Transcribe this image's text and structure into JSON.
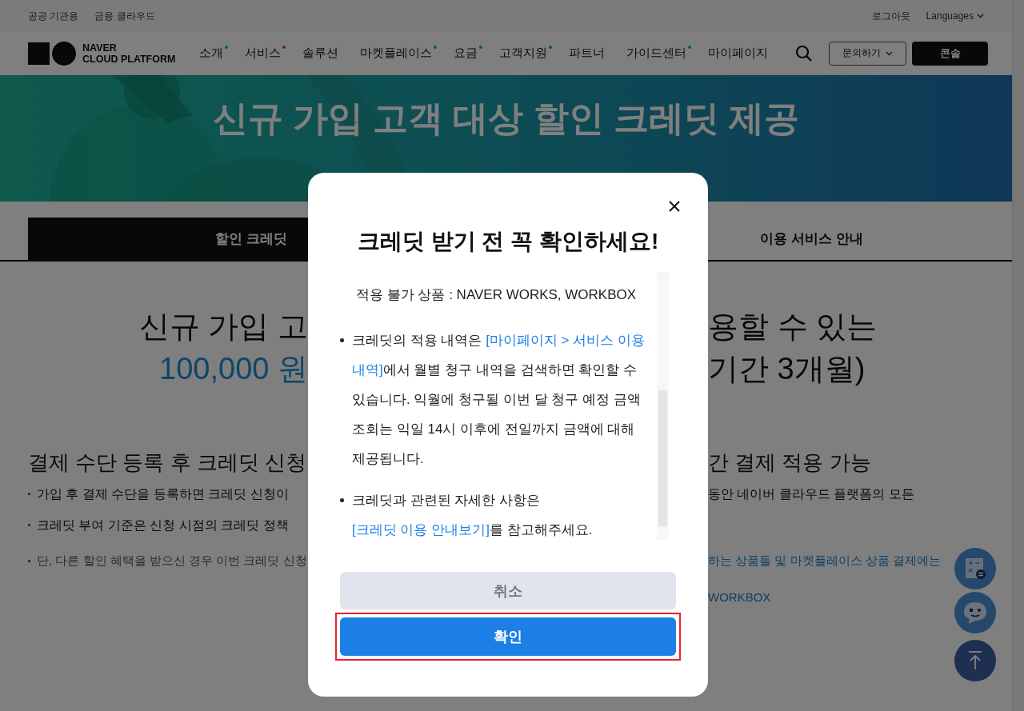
{
  "top_bar": {
    "left_links": [
      "공공 기관용",
      "금융 클라우드"
    ],
    "right_links": [
      "로그아웃",
      "Languages"
    ]
  },
  "logo": {
    "line_1": "NAVER",
    "line_2": "CLOUD PLATFORM"
  },
  "nav": [
    {
      "label": "소개",
      "color": "#026430"
    },
    {
      "label": "서비스",
      "color": "#781926"
    },
    {
      "label": "솔루션"
    },
    {
      "label": "마켓플레이스",
      "color": "#026430"
    },
    {
      "label": "요금",
      "color": "#026430"
    },
    {
      "label": "고객지원",
      "color": "#026430"
    },
    {
      "label": "파트너"
    },
    {
      "label": "가이드센터",
      "color": "#026430"
    },
    {
      "label": "마이페이지"
    }
  ],
  "header_buttons": {
    "inquiry": "문의하기",
    "console": "콘솔"
  },
  "banner": {
    "title": "신규 가입 고객 대상 할인 크레딧 제공"
  },
  "tabs": [
    {
      "label": "할인 크레딧",
      "selected": true
    },
    {
      "label": "이용 서비스 안내",
      "selected": false
    }
  ],
  "content_rows": [
    {
      "kind": "headline",
      "left": "신규 가입 고",
      "right": "용할 수 있는"
    },
    {
      "kind": "amount",
      "left": "100,000 원",
      "right": "기간 3개월)"
    },
    {
      "kind": "heading",
      "left": "결제 수단 등록 후 크레딧 신청",
      "right": "간 결제 적용 가능"
    },
    {
      "kind": "bullet",
      "left": "가입 후 결제 수단을 등록하면 크레딧 신청이",
      "right": "동안 네이버 클라우드 플랫폼의 모든"
    },
    {
      "kind": "bullet",
      "left": "크레딧 부여 기준은 신청 시점의 크레딧 정책",
      "right": ""
    },
    {
      "kind": "note",
      "left": "단, 다른 할인 혜택을 받으신 경우 이번 크레딧 신청",
      "right": "하는 상품들 및 마켓플레이스 상품 결제에는"
    },
    {
      "kind": "note_cont",
      "left": "",
      "right": "WORKBOX"
    }
  ],
  "modal": {
    "title": "크레딧 받기 전 꼭 확인하세요!",
    "items": [
      {
        "kind": "plain",
        "segments": [
          {
            "kind": "text",
            "text": "적용 불가 상품 : NAVER WORKS, WORKBOX"
          }
        ]
      },
      {
        "kind": "bullet",
        "segments": [
          {
            "kind": "text",
            "text": "크레딧의 적용 내역은 "
          },
          {
            "kind": "link",
            "text": "[마이페이지 > 서비스 이용"
          },
          {
            "kind": "link",
            "text": "내역]"
          },
          {
            "kind": "text",
            "text": "에서 월별 청구 내역을 검색하면 확인할 수 있습니다. 익월에 청구될 이번 달 청구 예정 금액 조회는 익일 14시 이후에 전일까지 금액에 대해 제공됩니다."
          }
        ]
      },
      {
        "kind": "bullet",
        "segments": [
          {
            "kind": "text",
            "text": "크레딧과 관련된 자세한 사항은 "
          },
          {
            "kind": "link",
            "text": "[크레딧 이용 안내"
          },
          {
            "kind": "link",
            "text": "보기]"
          },
          {
            "kind": "text",
            "text": "를 참고해주세요."
          }
        ]
      }
    ],
    "cancel": "취소",
    "confirm": "확인",
    "confirm_highlighted": true
  }
}
